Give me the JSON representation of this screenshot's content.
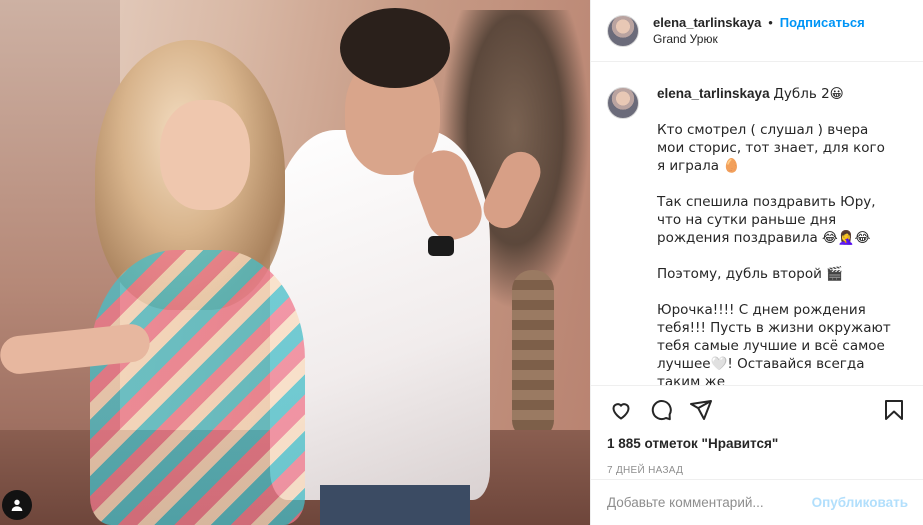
{
  "post": {
    "username": "elena_tarlinskaya",
    "follow_label": "Подписаться",
    "separator": "•",
    "location": "Grand Урюк"
  },
  "caption": {
    "username": "elena_tarlinskaya",
    "title": "Дубль 2😀",
    "para1": "Кто смотрел ( слушал ) вчера мои сторис, тот знает, для кого я играла 🥚",
    "para2": "Так спешила поздравить Юру, что на сутки раньше дня рождения поздравила 😂🤦‍♀️😂",
    "para3": "Поэтому, дубль второй 🎬",
    "para4": "Юрочка!!!! С днем рождения тебя!!! Пусть в жизни окружают тебя самые лучшие и всё самое лучшее🤍! Оставайся всегда таким же"
  },
  "actions": {
    "like_icon": "heart-icon",
    "comment_icon": "comment-icon",
    "share_icon": "share-icon",
    "save_icon": "bookmark-icon",
    "likes_text": "1 885 отметок \"Нравится\"",
    "date_text": "7 ДНЕЙ НАЗАД"
  },
  "comment_box": {
    "placeholder": "Добавьте комментарий...",
    "publish_label": "Опубликовать"
  },
  "colors": {
    "accent": "#0095f6",
    "publish_disabled": "#b2dffc",
    "muted": "#8e8e8e"
  }
}
